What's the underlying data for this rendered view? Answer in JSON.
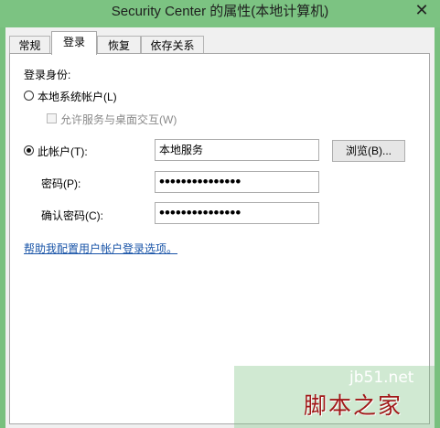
{
  "window": {
    "title": "Security Center 的属性(本地计算机)",
    "close_glyph": "✕"
  },
  "tabs": [
    {
      "label": "常规",
      "active": false
    },
    {
      "label": "登录",
      "active": true
    },
    {
      "label": "恢复",
      "active": false
    },
    {
      "label": "依存关系",
      "active": false
    }
  ],
  "logon": {
    "section_label": "登录身份:",
    "local_system": {
      "label": "本地系统帐户(L)",
      "selected": false
    },
    "interact_desktop": {
      "label": "允许服务与桌面交互(W)",
      "checked": false,
      "enabled": false
    },
    "this_account": {
      "label": "此帐户(T):",
      "selected": true,
      "value": "本地服务"
    },
    "browse_button": "浏览(B)...",
    "password": {
      "label": "密码(P):",
      "value": "•••••••••••••••"
    },
    "confirm_password": {
      "label": "确认密码(C):",
      "value": "•••••••••••••••"
    },
    "help_link": "帮助我配置用户帐户登录选项。"
  },
  "watermark": {
    "url": "jb51.net",
    "name": "脚本之家"
  },
  "colors": {
    "titlebar": "#7cc382",
    "link": "#1a55a8",
    "watermark_text": "#a01818"
  }
}
